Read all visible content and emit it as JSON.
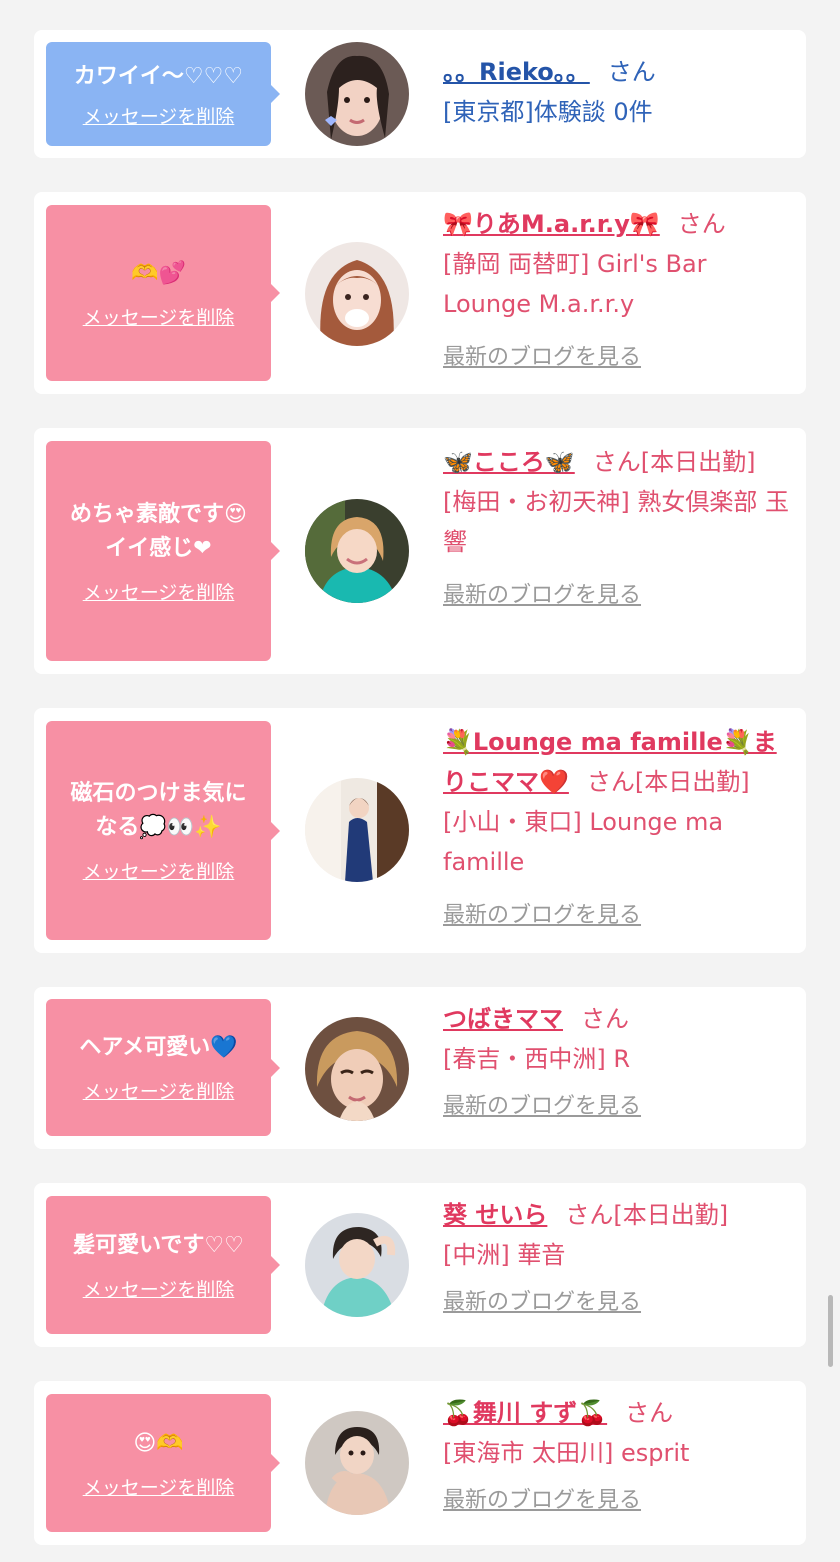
{
  "delete_label": "メッセージを削除",
  "blog_label": "最新のブログを見る",
  "colors": {
    "page_bg": "#f3f3f3",
    "pink_bubble": "#f790a4",
    "blue_bubble": "#8ab4f3",
    "pink_text": "#e0506f",
    "blue_text": "#2f63b8",
    "link_gray": "#9a9a9a"
  },
  "items": [
    {
      "theme": "blue",
      "message": "カワイイ〜♡♡♡",
      "name": "。。Rieko。。",
      "san": "さん",
      "shop": "[東京都]体験談 0件",
      "has_blog": false
    },
    {
      "theme": "pink",
      "message": "🫶💕",
      "name": "🎀りあM.a.r.r.y🎀",
      "san": "さん",
      "shop": "[静岡 両替町] Girl's Bar Lounge M.a.r.r.y",
      "has_blog": true
    },
    {
      "theme": "pink",
      "message": "めちゃ素敵です😍\nイイ感じ❤",
      "name": "🦋こころ🦋",
      "san": "さん[本日出勤]",
      "shop": "[梅田・お初天神] 熟女倶楽部 玉響",
      "has_blog": true
    },
    {
      "theme": "pink",
      "message": "磁石のつけま気に\nなる💭👀✨",
      "name": "💐Lounge ma famille💐まりこママ❤️",
      "san": "さん[本日出勤]",
      "shop": "[小山・東口] Lounge ma famille",
      "has_blog": true
    },
    {
      "theme": "pink",
      "message": "ヘアメ可愛い💙",
      "name": "つばきママ",
      "san": "さん",
      "shop": "[春吉・西中洲] R",
      "has_blog": true
    },
    {
      "theme": "pink",
      "message": "髪可愛いです♡♡",
      "name": "葵 せいら",
      "san": "さん[本日出勤]",
      "shop": "[中洲] 華音",
      "has_blog": true
    },
    {
      "theme": "pink",
      "message": "😍🫶",
      "name": "🍒舞川 すず🍒",
      "san": "さん",
      "shop": "[東海市 太田川] esprit",
      "has_blog": true
    }
  ]
}
